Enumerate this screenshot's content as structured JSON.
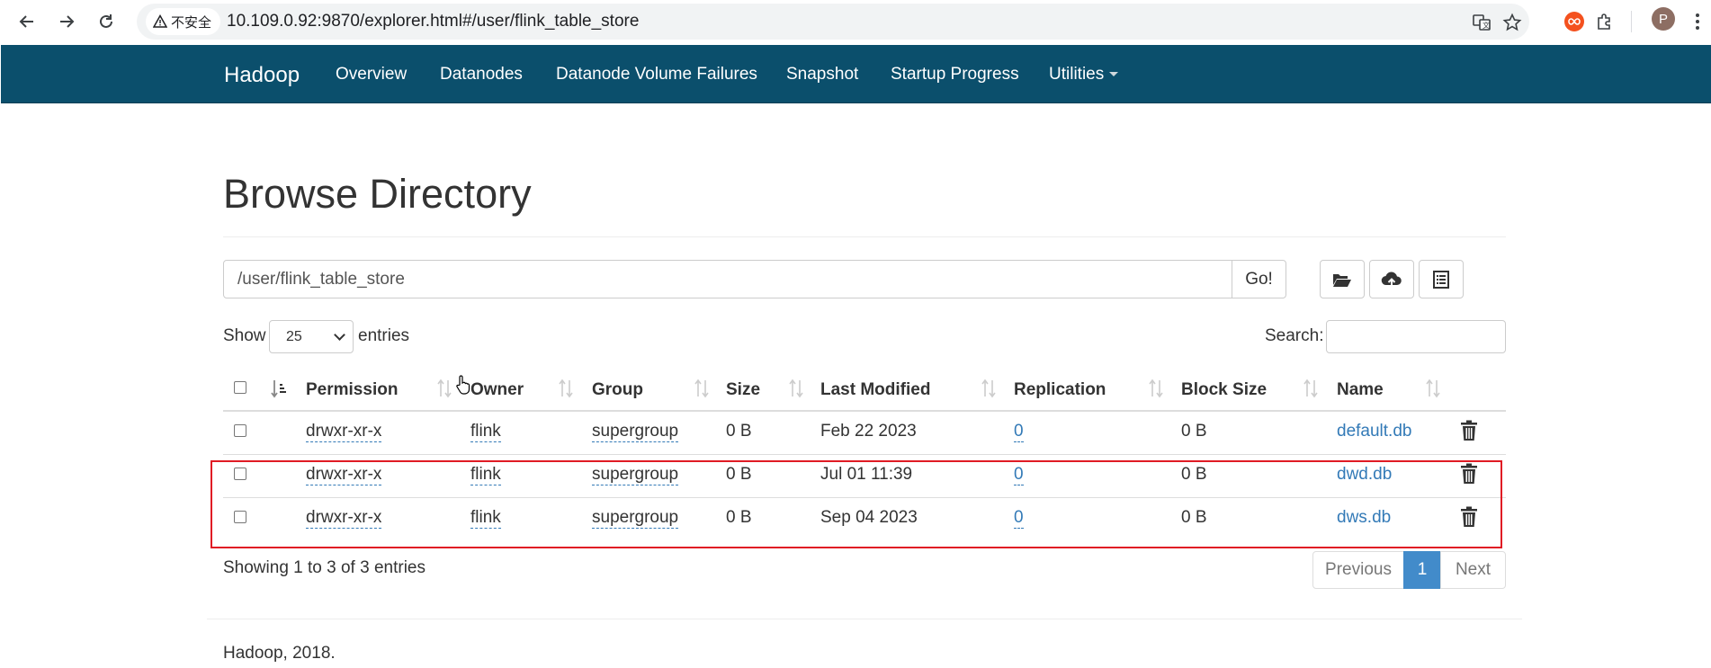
{
  "browser": {
    "security_label": "不安全",
    "url": "10.109.0.92:9870/explorer.html#/user/flink_table_store",
    "profile_initial": "P"
  },
  "navbar": {
    "brand": "Hadoop",
    "items": [
      "Overview",
      "Datanodes",
      "Datanode Volume Failures",
      "Snapshot",
      "Startup Progress",
      "Utilities"
    ],
    "bg_color": "#0b4f6c"
  },
  "page": {
    "title": "Browse Directory",
    "path_value": "/user/flink_table_store",
    "go_label": "Go!",
    "show_label": "Show",
    "page_size": "25",
    "entries_label": "entries",
    "search_label": "Search:",
    "search_value": ""
  },
  "table": {
    "headers": [
      "Permission",
      "Owner",
      "Group",
      "Size",
      "Last Modified",
      "Replication",
      "Block Size",
      "Name"
    ],
    "rows": [
      {
        "permission": "drwxr-xr-x",
        "owner": "flink",
        "group": "supergroup",
        "size": "0 B",
        "modified": "Feb 22 2023",
        "replication": "0",
        "block_size": "0 B",
        "name": "default.db"
      },
      {
        "permission": "drwxr-xr-x",
        "owner": "flink",
        "group": "supergroup",
        "size": "0 B",
        "modified": "Jul 01 11:39",
        "replication": "0",
        "block_size": "0 B",
        "name": "dwd.db"
      },
      {
        "permission": "drwxr-xr-x",
        "owner": "flink",
        "group": "supergroup",
        "size": "0 B",
        "modified": "Sep 04 2023",
        "replication": "0",
        "block_size": "0 B",
        "name": "dws.db"
      }
    ]
  },
  "table_info": "Showing 1 to 3 of 3 entries",
  "pagination": {
    "previous": "Previous",
    "current": "1",
    "next": "Next"
  },
  "footer": "Hadoop, 2018.",
  "colors": {
    "link": "#337ab7",
    "highlight": "#e01b24",
    "active_page": "#428bca"
  }
}
